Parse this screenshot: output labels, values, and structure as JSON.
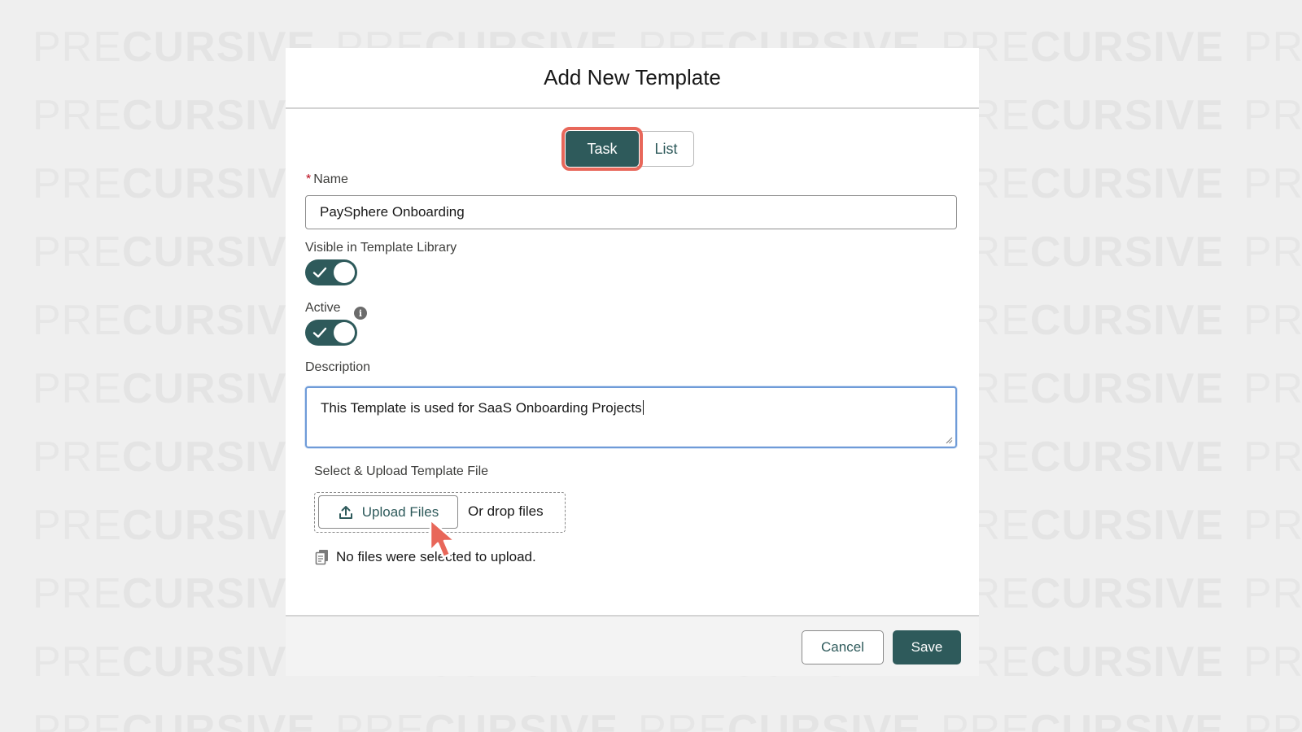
{
  "watermark": {
    "light": "PRE",
    "bold": "CURSIVE"
  },
  "modal": {
    "title": "Add New Template",
    "tabs": [
      {
        "label": "Task",
        "selected": true
      },
      {
        "label": "List",
        "selected": false
      }
    ],
    "name": {
      "required_marker": "*",
      "label": "Name",
      "value": "PaySphere Onboarding"
    },
    "visible_in_library": {
      "label": "Visible in Template Library",
      "checked": true
    },
    "active": {
      "label": "Active",
      "checked": true,
      "info_icon": "info-icon"
    },
    "description": {
      "label": "Description",
      "value": "This Template is used for SaaS Onboarding Projects"
    },
    "upload": {
      "label": "Select & Upload Template File",
      "button_label": "Upload Files",
      "drop_text": "Or drop files",
      "status": "No files were selected to upload."
    },
    "footer": {
      "cancel_label": "Cancel",
      "save_label": "Save"
    }
  },
  "colors": {
    "brand": "#2e5a5b",
    "highlight": "#e8675a",
    "focus": "#6f9bd8"
  }
}
